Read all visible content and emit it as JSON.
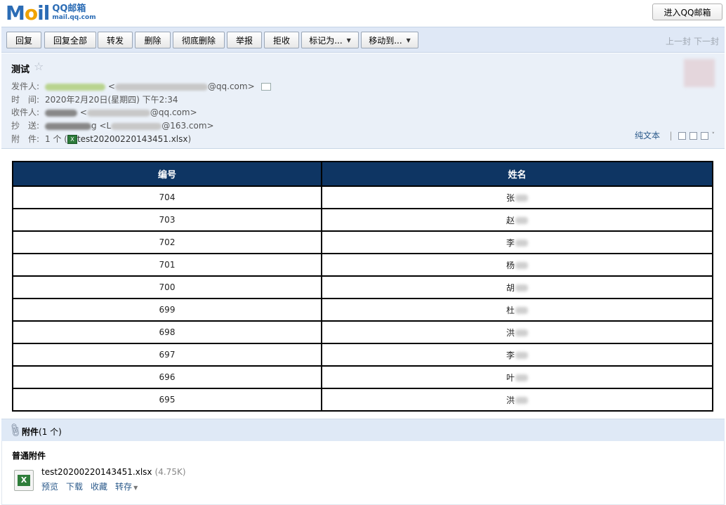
{
  "header": {
    "logo_mail": "Mail",
    "logo_brand": "QQ邮箱",
    "logo_url": "mail.qq.com",
    "enter_button": "进入QQ邮箱"
  },
  "toolbar": {
    "reply": "回复",
    "reply_all": "回复全部",
    "forward": "转发",
    "delete": "删除",
    "delete_permanently": "彻底删除",
    "report": "举报",
    "reject": "拒收",
    "mark_as": "标记为...",
    "move_to": "移动到...",
    "prev": "上一封",
    "next": "下一封"
  },
  "mail": {
    "subject": "测试",
    "from_label": "发件人:",
    "from_email_suffix": "@qq.com>",
    "time_label": "时　间:",
    "time_value": "2020年2月20日(星期四) 下午2:34",
    "to_label": "收件人:",
    "to_email_suffix": "@qq.com>",
    "cc_label": "抄　送:",
    "cc_name_suffix": "g",
    "cc_email_prefix": "<L",
    "cc_email_suffix": "@163.com>",
    "attach_label": "附　件:",
    "attach_count": "1 个 (",
    "attach_file": "test20200220143451.xlsx",
    "attach_close": ")",
    "plain_text": "纯文本",
    "lt": "<"
  },
  "table": {
    "headers": [
      "编号",
      "姓名"
    ],
    "rows": [
      {
        "id": "704",
        "name": "张"
      },
      {
        "id": "703",
        "name": "赵"
      },
      {
        "id": "702",
        "name": "李"
      },
      {
        "id": "701",
        "name": "杨"
      },
      {
        "id": "700",
        "name": "胡"
      },
      {
        "id": "699",
        "name": "杜"
      },
      {
        "id": "698",
        "name": "洪"
      },
      {
        "id": "697",
        "name": "李"
      },
      {
        "id": "696",
        "name": "叶"
      },
      {
        "id": "695",
        "name": "洪"
      }
    ]
  },
  "attachments": {
    "title": "附件",
    "count": "(1 个)",
    "section": "普通附件",
    "file_name": "test20200220143451.xlsx",
    "file_size": "(4.75K)",
    "actions": [
      "预览",
      "下载",
      "收藏",
      "转存"
    ]
  }
}
